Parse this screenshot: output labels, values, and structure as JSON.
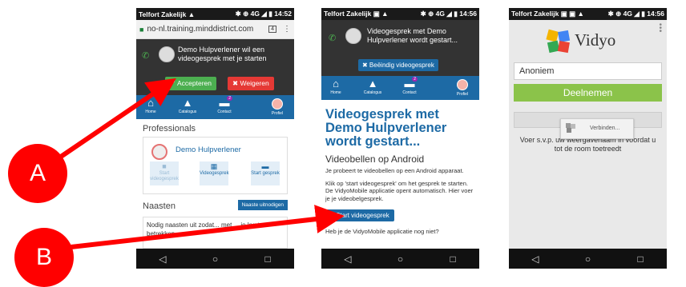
{
  "colors": {
    "brand_blue": "#1d6aa5",
    "accept_green": "#4caf50",
    "reject_red": "#e53935",
    "join_green": "#8bc34a",
    "annotation_red": "#ff0000"
  },
  "phone1": {
    "status_left": "Telfort Zakelijk ▲",
    "status_right": "✱ ⊕ 4G ◢ ▮ 14:52",
    "url": "no-nl.training.minddistrict.com",
    "tab_count": "4",
    "notification": {
      "message": "Demo Hulpverlener wil een videogesprek met je starten",
      "accept": "✔ Accepteren",
      "reject": "✖ Weigeren"
    },
    "nav": [
      {
        "label": "Home",
        "icon": "home-icon"
      },
      {
        "label": "Catalogus",
        "icon": "graduation-cap-icon"
      },
      {
        "label": "Contact",
        "icon": "chat-icon",
        "badge": "2"
      },
      {
        "label": "Profiel",
        "icon": "profile-icon"
      }
    ],
    "professionals_title": "Professionals",
    "contact_name": "Demo Hulpverlener",
    "actions": [
      "Start videogesprek",
      "Videogesprek",
      "Start gesprek"
    ],
    "naasten_title": "Naasten",
    "naasten_button": "Naaste uitnodigen",
    "naasten_text": "Nodig naasten uit zodat... met ... je kunt betrekken"
  },
  "phone2": {
    "status_left": "Telfort Zakelijk ▣ ▲",
    "status_right": "✱ ⊕ 4G ◢ ▮ 14:56",
    "notification": {
      "message": "Videogesprek met Demo Hulpverlener wordt gestart...",
      "end_button": "✖ Beëindig videogesprek"
    },
    "nav": [
      {
        "label": "Home"
      },
      {
        "label": "Catalogus"
      },
      {
        "label": "Contact",
        "badge": "2"
      },
      {
        "label": "Profiel"
      }
    ],
    "heading": "Videogesprek met Demo Hulpverlener wordt gestart...",
    "subheading": "Videobellen op Android",
    "para1": "Je probeert te videobellen op een Android apparaat.",
    "para2": "Klik op 'start videogesprek' om het gesprek te starten. De VidyoMobile applicatie opent automatisch. Hier voer je je videobelgesprek.",
    "start_button": "■ Start videogesprek",
    "para3": "Heb je de VidyoMobile applicatie nog niet?"
  },
  "phone3": {
    "status_left": "Telfort Zakelijk ▣ ▣ ▲",
    "status_right": "✱ ⊕ 4G ◢ ▮ 14:56",
    "logo_text": "Vidyo",
    "name_value": "Anoniem",
    "join_button": "Deelnemen",
    "connecting": "Verbinden...",
    "info_text": "Voer s.v.p. uw weergavenaam in voordat u tot de room toetreedt"
  },
  "annotations": {
    "a": "A",
    "b": "B"
  },
  "navbar_icons": {
    "back": "◁",
    "home": "○",
    "recent": "□"
  }
}
